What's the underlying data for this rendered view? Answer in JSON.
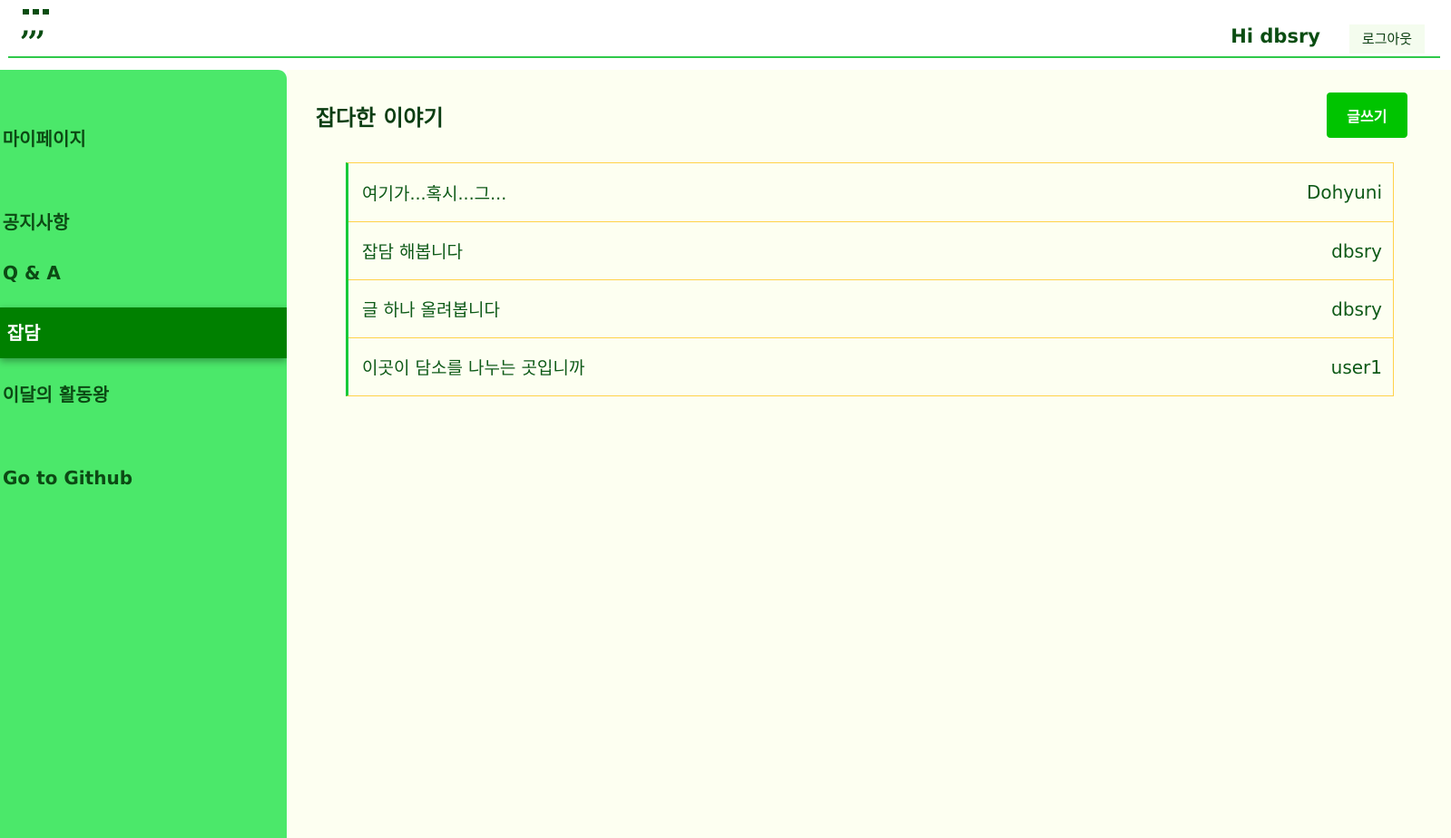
{
  "header": {
    "logo_glyph": ",,,",
    "greeting": "Hi dbsry",
    "logout_label": "로그아웃"
  },
  "sidebar": {
    "items": [
      {
        "label": "마이페이지",
        "active": false
      },
      {
        "label": "공지사항",
        "active": false
      },
      {
        "label": "Q & A",
        "active": false
      },
      {
        "label": "잡담",
        "active": true
      },
      {
        "label": "이달의 활동왕",
        "active": false
      },
      {
        "label": "Go to Github",
        "active": false
      }
    ]
  },
  "main": {
    "title": "잡다한 이야기",
    "write_label": "글쓰기",
    "posts": [
      {
        "title": "여기가...혹시...그...",
        "author": "Dohyuni"
      },
      {
        "title": "잡담 해봅니다",
        "author": "dbsry"
      },
      {
        "title": "글 하나 올려봅니다",
        "author": "dbsry"
      },
      {
        "title": "이곳이 담소를 나누는 곳입니까",
        "author": "user1"
      }
    ]
  },
  "colors": {
    "sidebar_bg": "#4be86a",
    "active_nav_bg": "#008000",
    "accent_button": "#00c400",
    "main_bg": "#fdfff1",
    "row_border": "#ffd24a",
    "list_left_bar": "#17c93a"
  }
}
